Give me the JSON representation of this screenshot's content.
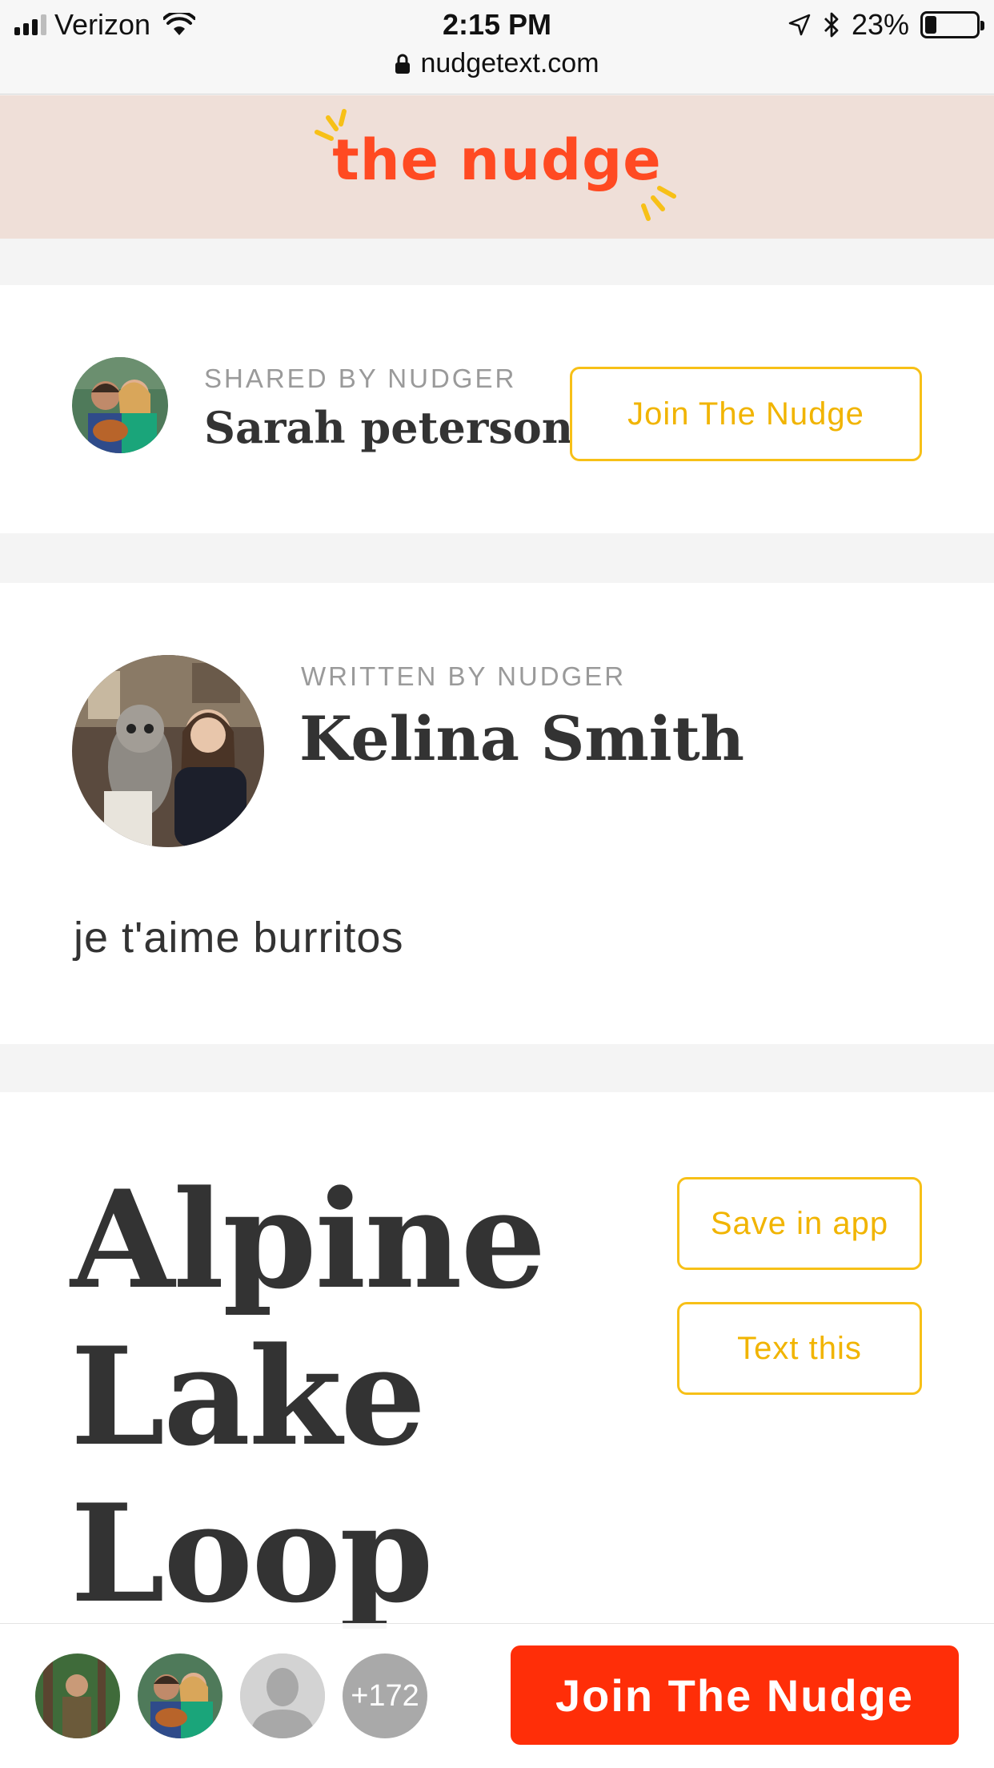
{
  "status_bar": {
    "carrier": "Verizon",
    "time": "2:15 PM",
    "url": "nudgetext.com",
    "battery": "23%",
    "battery_level": 0.23
  },
  "header": {
    "logo_text": "the nudge",
    "brand_color": "#ff4a22",
    "accent_color": "#f7c017"
  },
  "shared_card": {
    "eyebrow": "SHARED BY NUDGER",
    "name": "Sarah peterson",
    "join_label": "Join The Nudge"
  },
  "written_card": {
    "eyebrow": "WRITTEN BY NUDGER",
    "name": "Kelina Smith",
    "note": "je t'aime burritos"
  },
  "main": {
    "title_lines": [
      "Alpine",
      "Lake",
      "Loop"
    ],
    "save_label": "Save in app",
    "text_label": "Text this"
  },
  "bottom_bar": {
    "count_label": "+172",
    "join_label": "Join The Nudge"
  }
}
